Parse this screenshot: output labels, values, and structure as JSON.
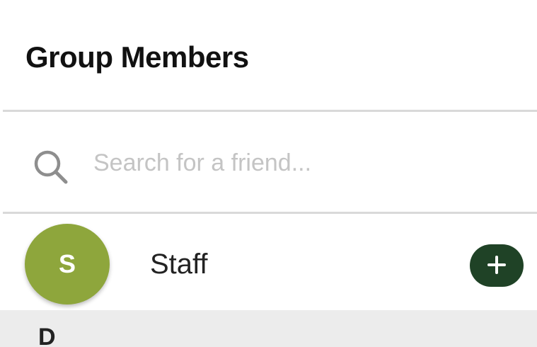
{
  "header": {
    "title": "Group Members"
  },
  "search": {
    "icon": "search-icon",
    "value": "",
    "placeholder": "Search for a friend..."
  },
  "members": [
    {
      "avatar_letter": "S",
      "avatar_color": "#8ea63c",
      "name": "Staff",
      "action_icon": "plus-icon",
      "action_color": "#1f4226"
    }
  ],
  "sections": [
    {
      "letter": "D"
    }
  ],
  "colors": {
    "background": "#ffffff",
    "divider": "#d9d9d9",
    "section_header_bg": "#ececec",
    "placeholder": "#c4c4c4"
  }
}
